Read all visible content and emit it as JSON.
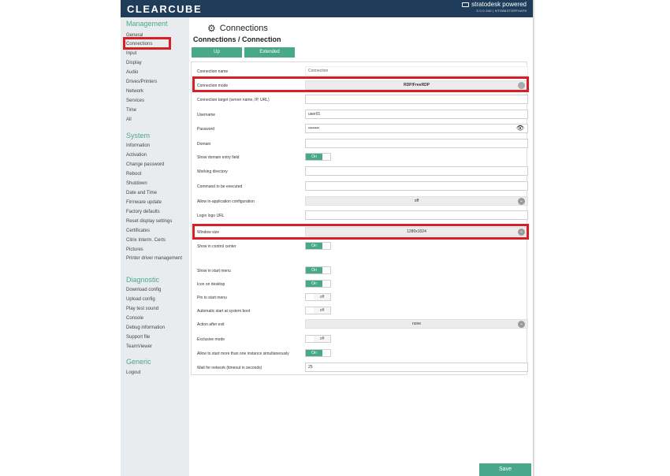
{
  "header": {
    "logo": "CLEARCUBE",
    "brand": "stratodesk powered",
    "version": "3.0.0.340 | NTOB63TORF4AF8"
  },
  "sidebar": {
    "sections": [
      {
        "title": "Management",
        "items": [
          "General",
          "Connections",
          "Input",
          "Display",
          "Audio",
          "Drives/Printers",
          "Network",
          "Services",
          "Time",
          "All"
        ]
      },
      {
        "title": "System",
        "items": [
          "Information",
          "Activation",
          "Change password",
          "Reboot",
          "Shutdown",
          "Date and Time",
          "Firmware update",
          "Factory defaults",
          "Reset display settings",
          "Certificates",
          "Citrix Interm. Certs",
          "Pictures",
          "Printer driver management"
        ]
      },
      {
        "title": "Diagnostic",
        "items": [
          "Download config",
          "Upload config",
          "Play test sound",
          "Console",
          "Debug information",
          "Support file",
          "TeamViewer"
        ]
      },
      {
        "title": "Generic",
        "items": [
          "Logout"
        ]
      }
    ]
  },
  "main": {
    "title": "Connections",
    "breadcrumb": "Connections / Connection",
    "tabs": [
      "Up",
      "Extended"
    ],
    "save_label": "Save"
  },
  "form": {
    "connection_name": {
      "label": "Connection name",
      "value": "Connection"
    },
    "connection_mode": {
      "label": "Connection mode",
      "value": "RDP/FreeRDP"
    },
    "connection_target": {
      "label": "Connection target (server name, IP, URL)",
      "value": ""
    },
    "username": {
      "label": "Username",
      "value": "user01"
    },
    "password": {
      "label": "Password",
      "value": "••••••••"
    },
    "domain": {
      "label": "Domain",
      "value": ""
    },
    "show_domain": {
      "label": "Show domain entry field",
      "state": "On"
    },
    "working_directory": {
      "label": "Working directory",
      "value": ""
    },
    "command": {
      "label": "Command to be executed",
      "value": ""
    },
    "allow_in_app": {
      "label": "Allow in-application configuration",
      "value": "off"
    },
    "login_logo": {
      "label": "Login logo URL",
      "value": ""
    },
    "window_size": {
      "label": "Window size",
      "value": "1280x1024"
    },
    "show_control_center": {
      "label": "Show in control center",
      "state": "On"
    },
    "show_start_menu": {
      "label": "Show in start menu",
      "state": "On"
    },
    "icon_desktop": {
      "label": "Icon on desktop",
      "state": "On"
    },
    "pin_start": {
      "label": "Pin to start menu",
      "state": "off"
    },
    "auto_start": {
      "label": "Automatic start at system boot",
      "state": "off"
    },
    "action_after_exit": {
      "label": "Action after exit",
      "value": "none"
    },
    "exclusive": {
      "label": "Exclusive mode",
      "state": "off"
    },
    "multi_instance": {
      "label": "Allow to start more than one instance simultaneously",
      "state": "On"
    },
    "wait_network": {
      "label": "Wait for network (timeout in seconds)",
      "value": "25"
    }
  },
  "colors": {
    "accent": "#4aa88a",
    "header": "#1f3d5a",
    "highlight": "#d91f26"
  }
}
